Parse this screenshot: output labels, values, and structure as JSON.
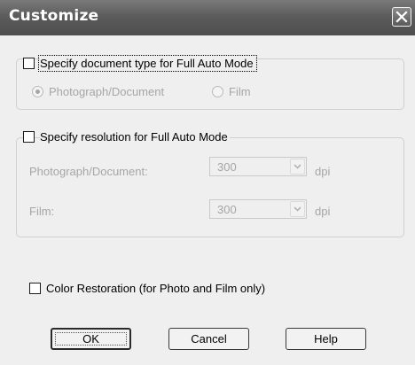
{
  "window": {
    "title": "Customize",
    "close_icon": "close-icon"
  },
  "doc_type_group": {
    "checkbox_label": "Specify document type for Full Auto Mode",
    "checked": false,
    "radio_photo_label": "Photograph/Document",
    "radio_photo_selected": true,
    "radio_film_label": "Film",
    "radio_film_selected": false
  },
  "resolution_group": {
    "checkbox_label": "Specify resolution for Full Auto Mode",
    "checked": false,
    "photo_label": "Photograph/Document:",
    "photo_value": "300",
    "photo_unit": "dpi",
    "film_label": "Film:",
    "film_value": "300",
    "film_unit": "dpi"
  },
  "color_restoration": {
    "checkbox_label": "Color Restoration (for Photo and Film only)",
    "checked": false
  },
  "buttons": {
    "ok": "OK",
    "cancel": "Cancel",
    "help": "Help"
  },
  "colors": {
    "title_bar": "#5c5c5c",
    "dialog_bg": "#efefef",
    "disabled_text": "#a6a6a6"
  }
}
